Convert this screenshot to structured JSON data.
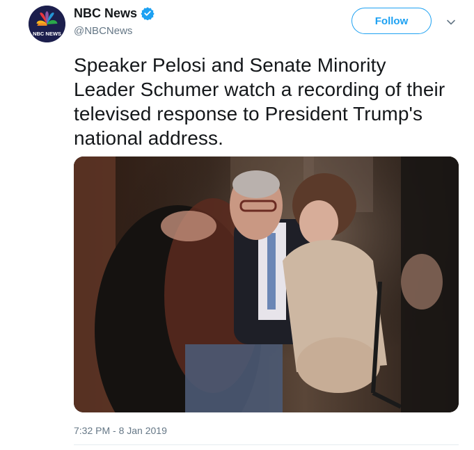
{
  "account": {
    "display_name": "NBC News",
    "handle": "@NBCNews",
    "verified": true,
    "avatar_text": "NBC NEWS",
    "avatar_icon": "nbc-peacock-logo"
  },
  "actions": {
    "follow_label": "Follow",
    "more_icon": "chevron-down-icon"
  },
  "tweet": {
    "text": "Speaker Pelosi and Senate Minority Leader Schumer watch a recording of their televised response to President Trump's national address.",
    "timestamp": "7:32 PM - 8 Jan 2019"
  },
  "colors": {
    "accent": "#1da1f2",
    "text": "#14171a",
    "secondary_text": "#657786",
    "divider": "#e6ecf0"
  }
}
